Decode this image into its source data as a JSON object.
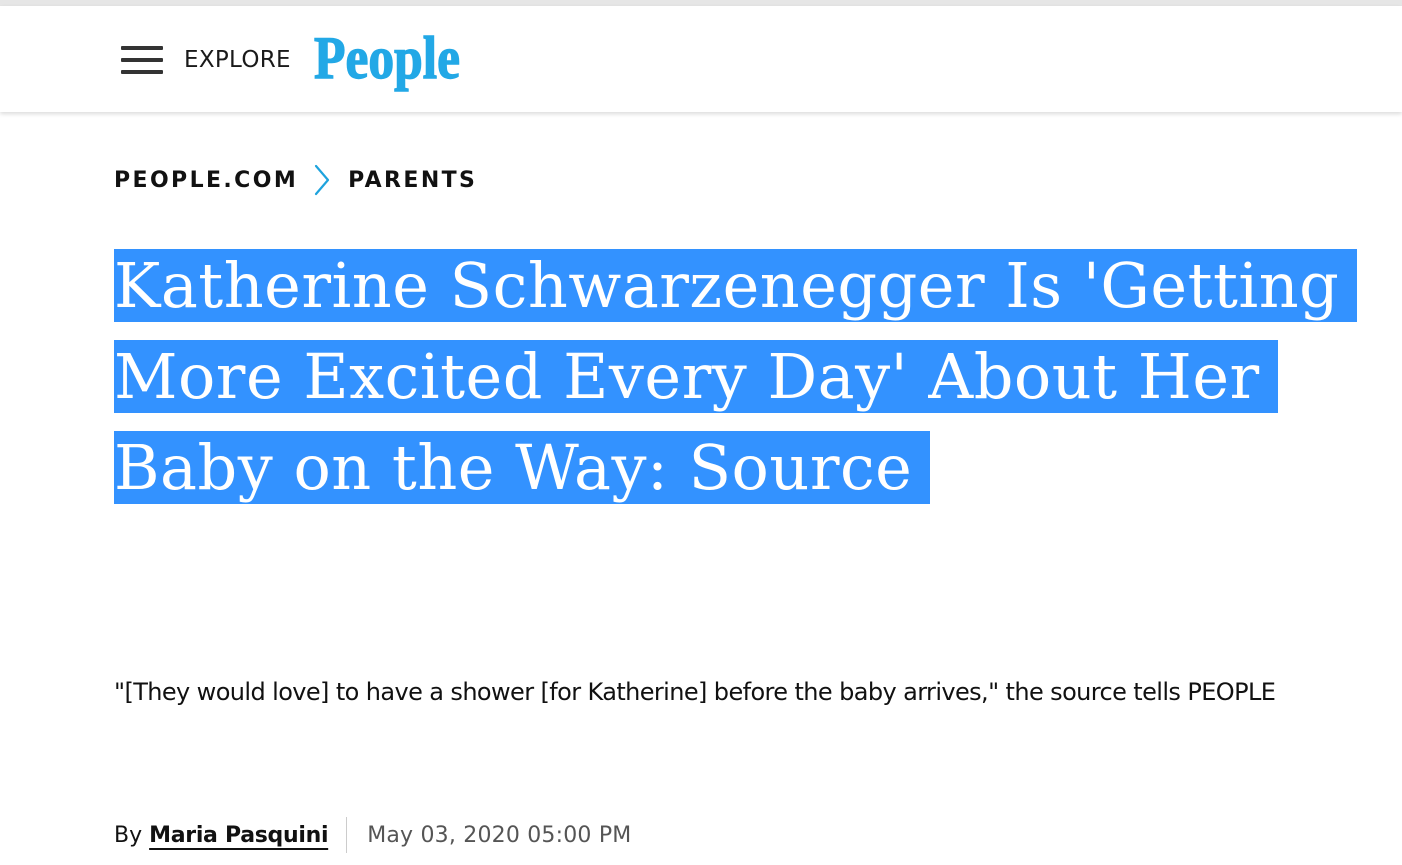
{
  "header": {
    "menu_icon": "hamburger-menu-icon",
    "explore_label": "EXPLORE",
    "logo_text": "People",
    "logo_color": "#22a8e6"
  },
  "breadcrumb": {
    "items": [
      {
        "label": "PEOPLE.COM"
      },
      {
        "label": "PARENTS"
      }
    ],
    "separator_icon": "chevron-right-icon",
    "separator_color": "#1ea3dd"
  },
  "article": {
    "headline": "Katherine Schwarzenegger Is 'Getting More Excited Every Day' About Her Baby on the Way: Source",
    "headline_selection_color": "#3392ff",
    "dek": "\"[They would love] to have a shower [for Katherine] before the baby arrives,\" the source tells PEOPLE",
    "byline": {
      "prefix": "By",
      "author": "Maria Pasquini",
      "date": "May 03, 2020 05:00 PM"
    }
  }
}
